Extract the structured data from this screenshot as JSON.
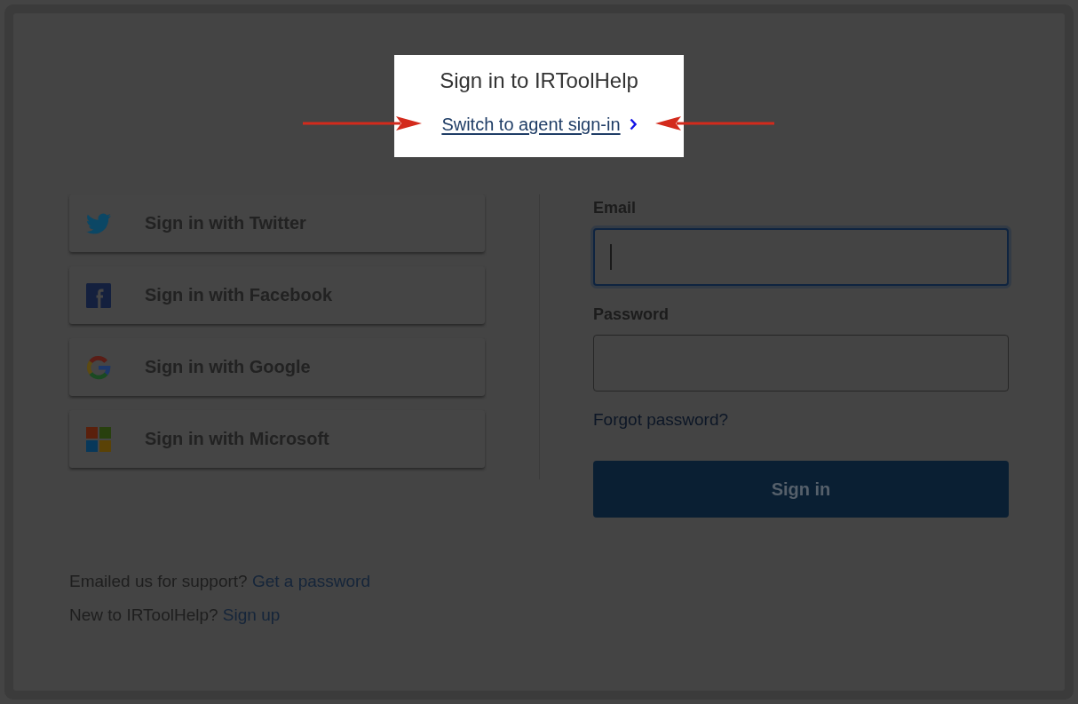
{
  "header": {
    "title": "Sign in to IRToolHelp",
    "agent_link": "Switch to agent sign-in"
  },
  "annotation_arrows": [
    {
      "kind": "rightward"
    },
    {
      "kind": "leftward"
    }
  ],
  "social_buttons": [
    {
      "kind": "bird",
      "label": "Sign in with Twitter"
    },
    {
      "kind": "f",
      "label": "Sign in with Facebook"
    },
    {
      "kind": "g",
      "label": "Sign in with Google"
    },
    {
      "kind": "squares",
      "label": "Sign in with Microsoft"
    }
  ],
  "form": {
    "fields": [
      {
        "label": "Email",
        "focused": true
      },
      {
        "label": "Password",
        "focused": false
      }
    ],
    "forgot_link": "Forgot password?",
    "submit": "Sign in"
  },
  "footer": [
    {
      "text": "Emailed us for support?",
      "link": "Get a password"
    },
    {
      "text": "New to IRToolHelp?",
      "link": "Sign up"
    }
  ]
}
